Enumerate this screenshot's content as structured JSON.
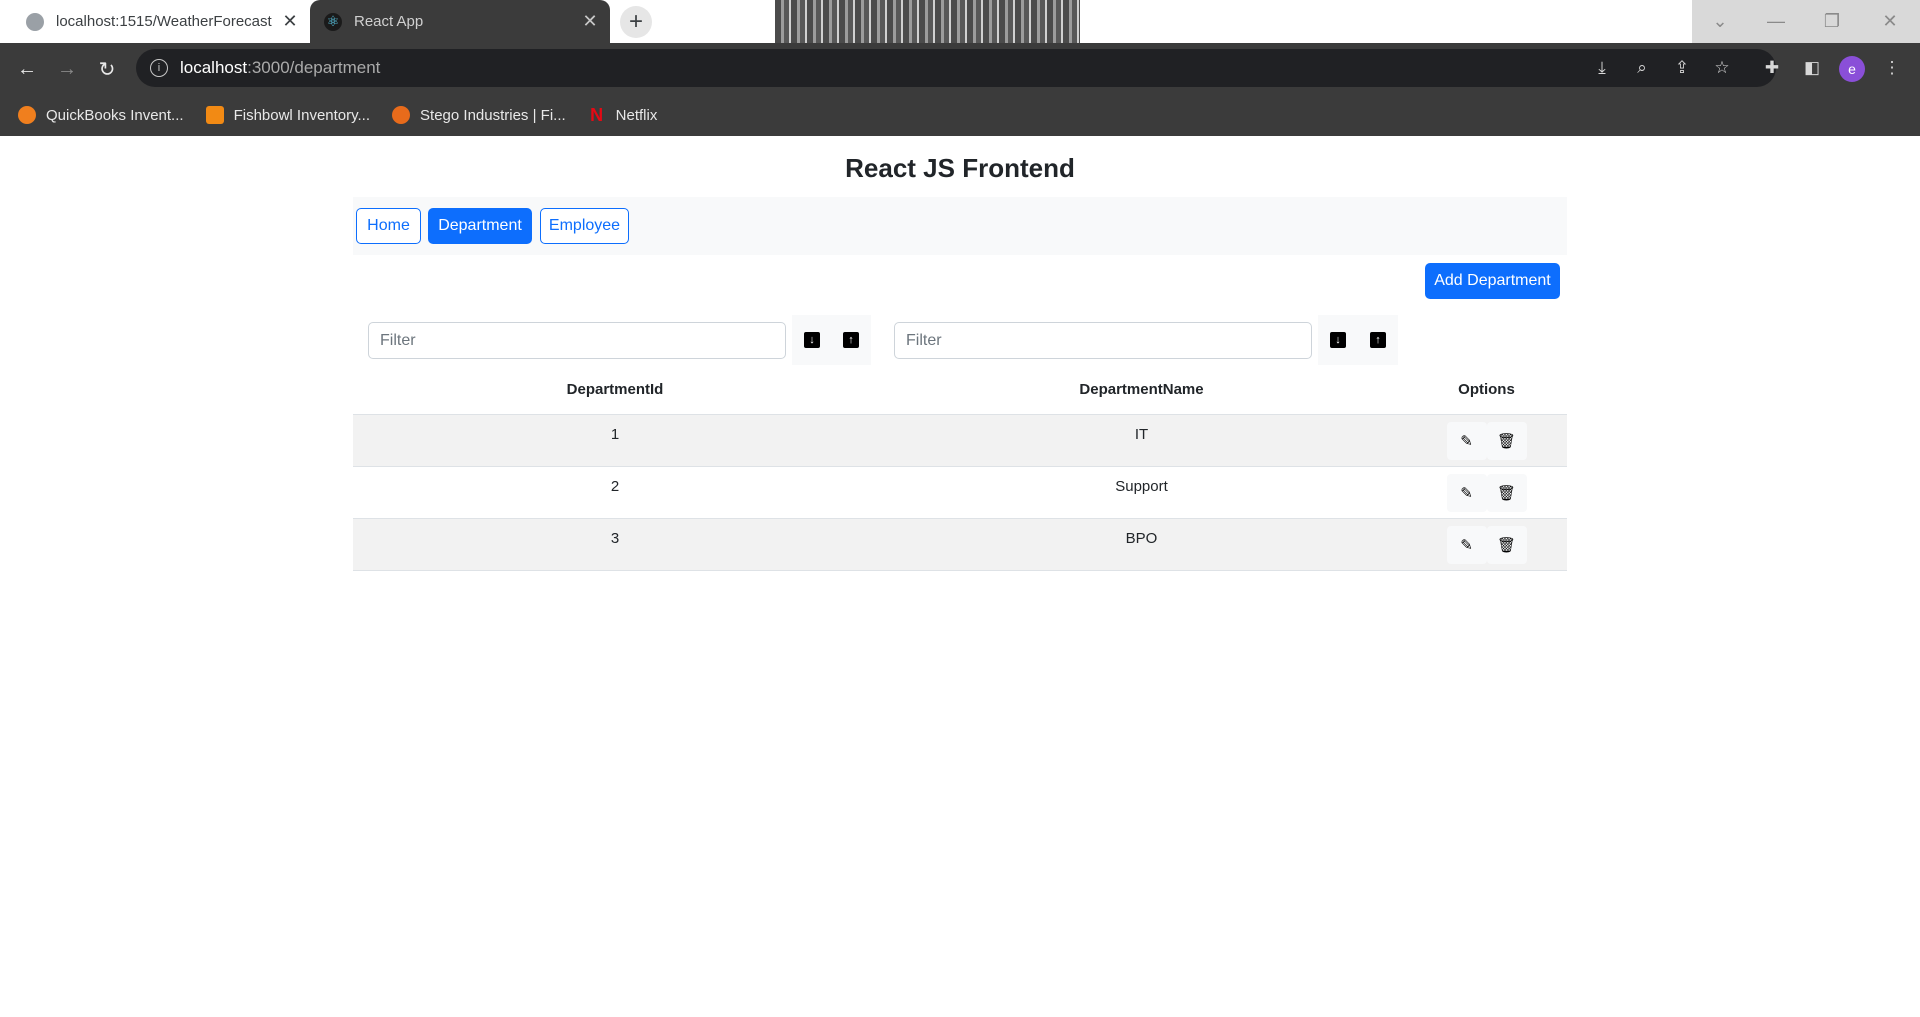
{
  "browser": {
    "tabs": [
      {
        "title": "localhost:1515/WeatherForecast",
        "favicon": "globe-icon",
        "active": false
      },
      {
        "title": "React App",
        "favicon": "react-icon",
        "active": true
      }
    ],
    "url_host": "localhost",
    "url_path": ":3000/department",
    "profile_initial": "e",
    "bookmarks": [
      {
        "label": "QuickBooks Invent...",
        "icon": "quickbooks-icon"
      },
      {
        "label": "Fishbowl Inventory...",
        "icon": "fishbowl-icon"
      },
      {
        "label": "Stego Industries | Fi...",
        "icon": "stego-icon"
      },
      {
        "label": "Netflix",
        "icon": "netflix-icon"
      }
    ]
  },
  "page": {
    "title": "React JS Frontend",
    "nav": {
      "home": "Home",
      "department": "Department",
      "employee": "Employee"
    },
    "add_button": "Add Department",
    "filters": {
      "id_placeholder": "Filter",
      "name_placeholder": "Filter"
    },
    "table": {
      "headers": [
        "DepartmentId",
        "DepartmentName",
        "Options"
      ],
      "rows": [
        {
          "id": "1",
          "name": "IT"
        },
        {
          "id": "2",
          "name": "Support"
        },
        {
          "id": "3",
          "name": "BPO"
        }
      ]
    }
  },
  "colors": {
    "primary": "#0d6efd",
    "chrome_dark": "#3b3b3b"
  }
}
